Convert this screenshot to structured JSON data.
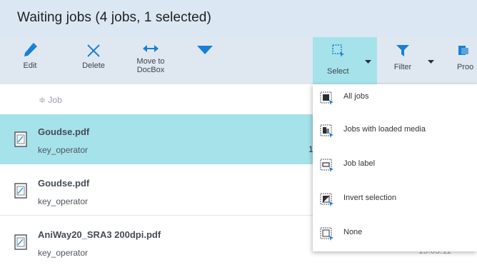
{
  "header": {
    "title": "Waiting jobs (4 jobs, 1 selected)"
  },
  "toolbar": {
    "edit_label": "Edit",
    "delete_label": "Delete",
    "move_label_line1": "Move to",
    "move_label_line2": "DocBox",
    "select_label": "Select",
    "filter_label": "Filter",
    "proof_label": "Proo"
  },
  "columns": {
    "job_label": "≑ Job"
  },
  "jobs": [
    {
      "name": "Goudse.pdf",
      "owner": "key_operator",
      "selected": true
    },
    {
      "name": "Goudse.pdf",
      "owner": "key_operator",
      "selected": false
    },
    {
      "name": "AniWay20_SRA3 200dpi.pdf",
      "owner": "key_operator",
      "selected": false
    }
  ],
  "partial_values": {
    "row1_trailing": "1",
    "row3_time": "15:05:11"
  },
  "select_menu": {
    "items": [
      {
        "label": "All jobs",
        "icon": "select-all-icon"
      },
      {
        "label": "Jobs with loaded media",
        "icon": "select-loaded-media-icon"
      },
      {
        "label": "Job label",
        "icon": "select-job-label-icon"
      },
      {
        "label": "Invert selection",
        "icon": "invert-selection-icon"
      },
      {
        "label": "None",
        "icon": "select-none-icon"
      }
    ]
  },
  "colors": {
    "accent": "#1a7fd4",
    "selected_row": "#a6e2ea",
    "header_bg": "#dbe7f2"
  }
}
